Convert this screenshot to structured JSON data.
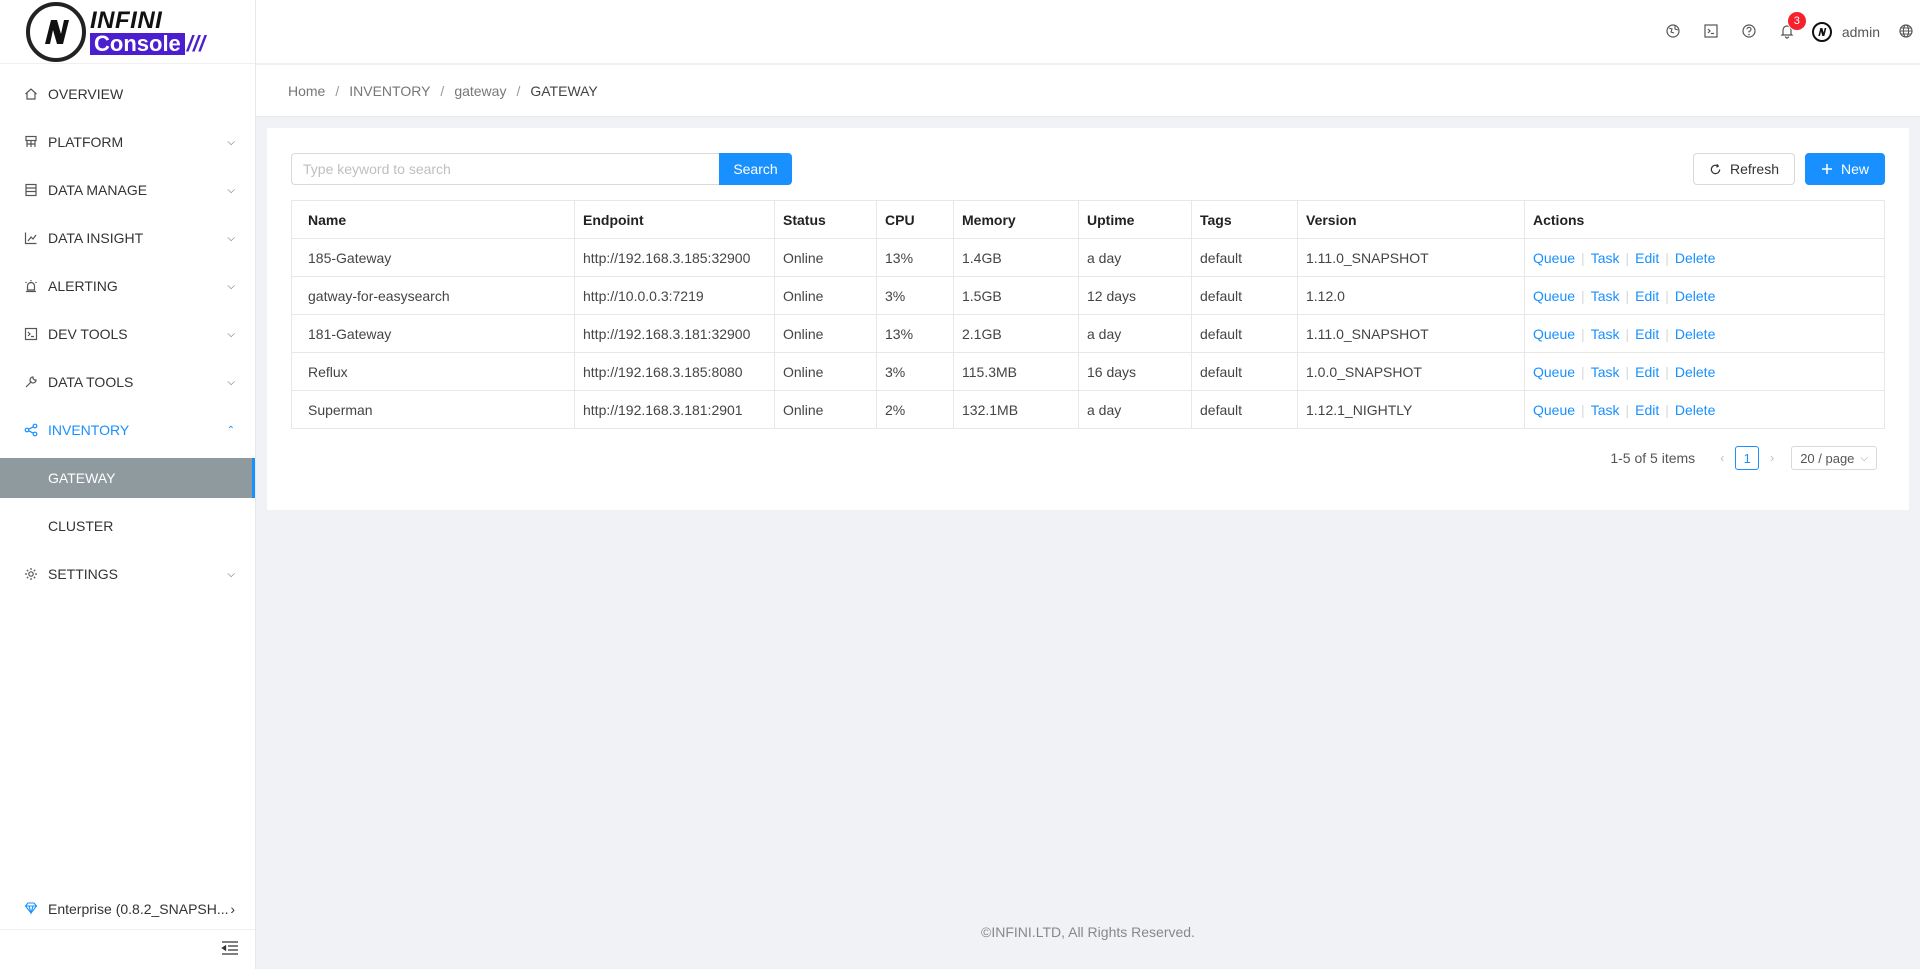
{
  "brand": {
    "top": "INFINI",
    "bottom": "Console",
    "slashes": "///"
  },
  "sidebar": {
    "items": [
      {
        "label": "OVERVIEW",
        "icon": "home-icon",
        "has_arrow": false
      },
      {
        "label": "PLATFORM",
        "icon": "platform-icon",
        "has_arrow": true
      },
      {
        "label": "DATA MANAGE",
        "icon": "database-icon",
        "has_arrow": true
      },
      {
        "label": "DATA INSIGHT",
        "icon": "chart-icon",
        "has_arrow": true
      },
      {
        "label": "ALERTING",
        "icon": "alarm-icon",
        "has_arrow": true
      },
      {
        "label": "DEV TOOLS",
        "icon": "terminal-icon",
        "has_arrow": true
      },
      {
        "label": "DATA TOOLS",
        "icon": "tool-icon",
        "has_arrow": true
      },
      {
        "label": "INVENTORY",
        "icon": "share-icon",
        "has_arrow": true,
        "open": true
      },
      {
        "label": "SETTINGS",
        "icon": "gear-icon",
        "has_arrow": true
      }
    ],
    "inventory_children": [
      "GATEWAY",
      "CLUSTER"
    ],
    "active_child": "GATEWAY",
    "version_label": "Enterprise (0.8.2_SNAPSH..."
  },
  "header": {
    "notification_count": "3",
    "user_name": "admin"
  },
  "breadcrumb": [
    "Home",
    "INVENTORY",
    "gateway",
    "GATEWAY"
  ],
  "search": {
    "placeholder": "Type keyword to search",
    "button": "Search"
  },
  "buttons": {
    "refresh": "Refresh",
    "new": "New"
  },
  "table": {
    "columns": [
      "Name",
      "Endpoint",
      "Status",
      "CPU",
      "Memory",
      "Uptime",
      "Tags",
      "Version",
      "Actions"
    ],
    "rows": [
      {
        "name": "185-Gateway",
        "endpoint": "http://192.168.3.185:32900",
        "status": "Online",
        "cpu": "13%",
        "memory": "1.4GB",
        "uptime": "a day",
        "tags": "default",
        "version": "1.11.0_SNAPSHOT"
      },
      {
        "name": "gatway-for-easysearch",
        "endpoint": "http://10.0.0.3:7219",
        "status": "Online",
        "cpu": "3%",
        "memory": "1.5GB",
        "uptime": "12 days",
        "tags": "default",
        "version": "1.12.0"
      },
      {
        "name": "181-Gateway",
        "endpoint": "http://192.168.3.181:32900",
        "status": "Online",
        "cpu": "13%",
        "memory": "2.1GB",
        "uptime": "a day",
        "tags": "default",
        "version": "1.11.0_SNAPSHOT"
      },
      {
        "name": "Reflux",
        "endpoint": "http://192.168.3.185:8080",
        "status": "Online",
        "cpu": "3%",
        "memory": "115.3MB",
        "uptime": "16 days",
        "tags": "default",
        "version": "1.0.0_SNAPSHOT"
      },
      {
        "name": "Superman",
        "endpoint": "http://192.168.3.181:2901",
        "status": "Online",
        "cpu": "2%",
        "memory": "132.1MB",
        "uptime": "a day",
        "tags": "default",
        "version": "1.12.1_NIGHTLY"
      }
    ],
    "actions": [
      "Queue",
      "Task",
      "Edit",
      "Delete"
    ]
  },
  "pagination": {
    "total_text": "1-5 of 5 items",
    "current_page": "1",
    "page_size": "20 / page"
  },
  "footer": "©INFINI.LTD, All Rights Reserved.",
  "colors": {
    "primary": "#1890ff",
    "online": "#2a9a2a",
    "brand_purple": "#4b1fd0",
    "active_bg": "#8f9a9e"
  }
}
